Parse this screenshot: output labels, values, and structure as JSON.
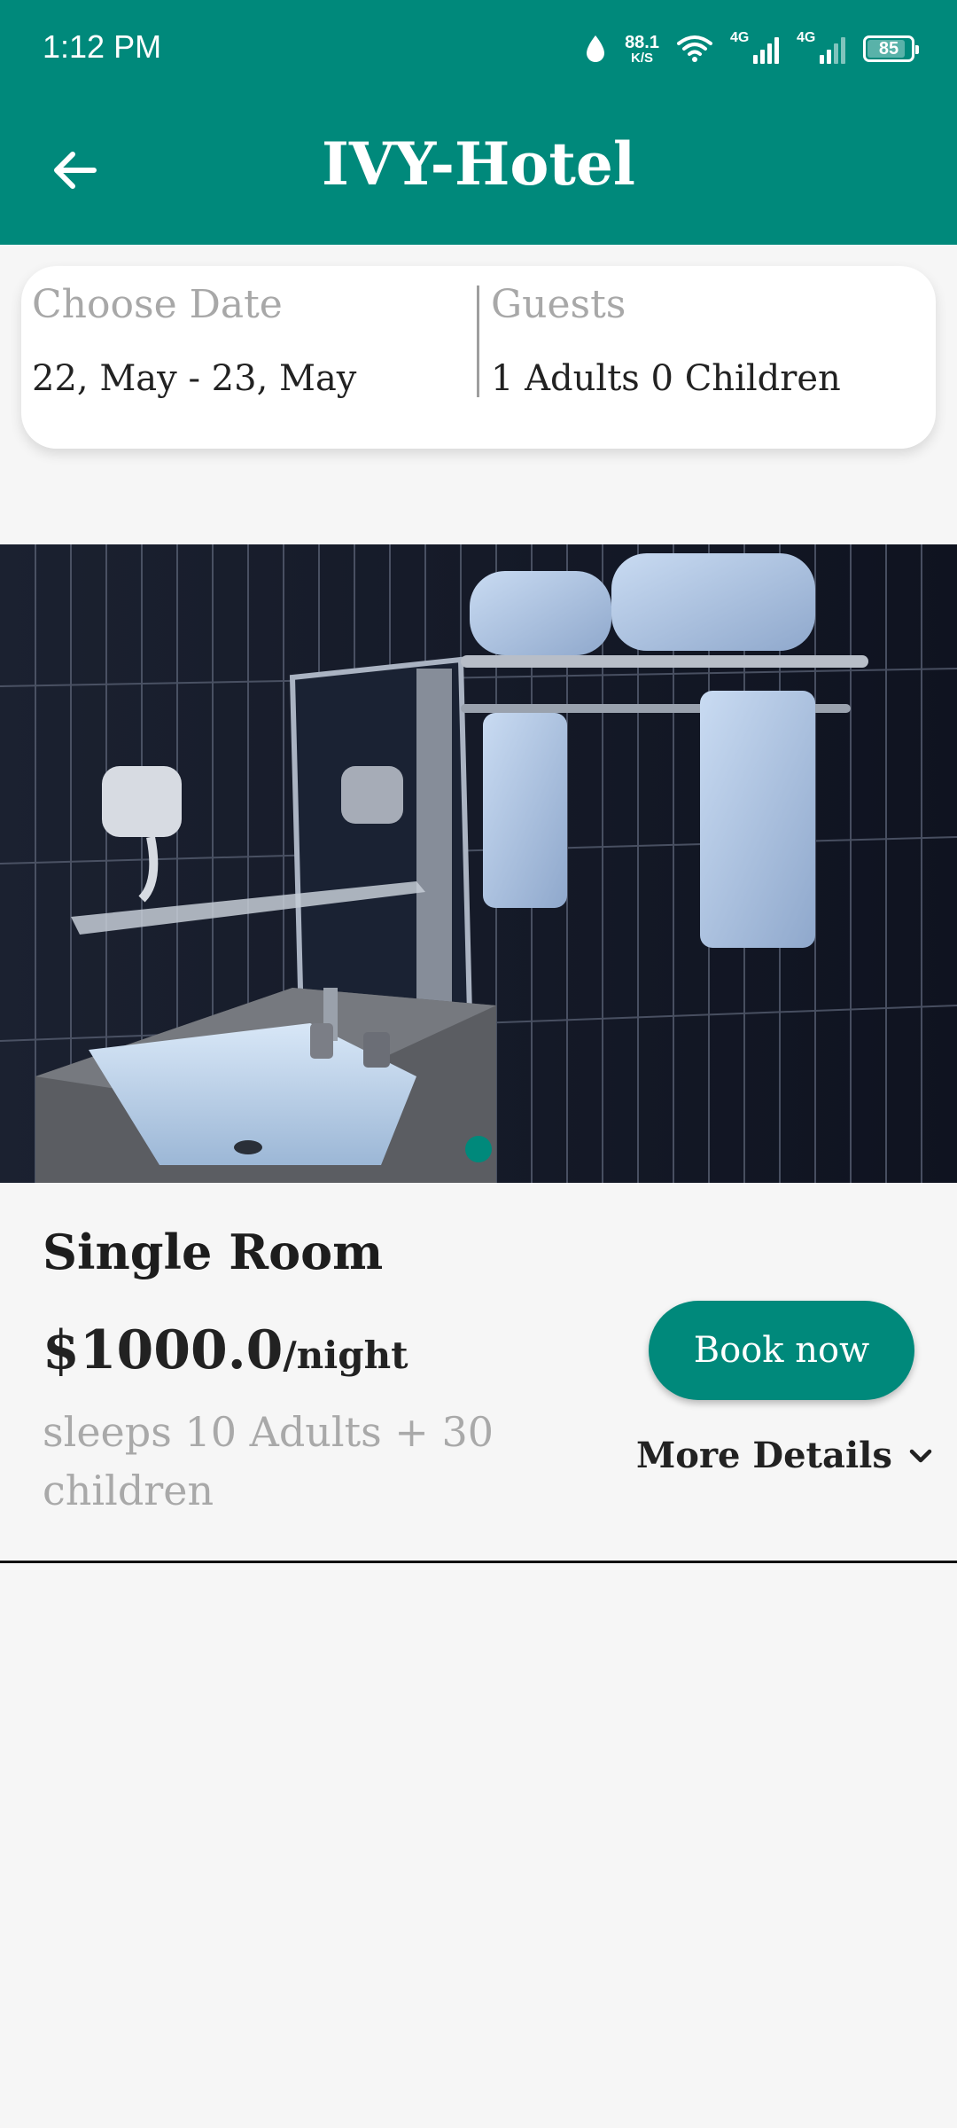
{
  "status_bar": {
    "time": "1:12 PM",
    "net_speed_value": "88.1",
    "net_speed_unit": "K/S",
    "signal1_label": "4G",
    "signal2_label": "4G",
    "battery_level": "85"
  },
  "header": {
    "title": "IVY-Hotel",
    "back_icon": "arrow-left-icon"
  },
  "search": {
    "date_label": "Choose Date",
    "date_value": "22, May - 23, May",
    "guests_label": "Guests",
    "guests_value": "1 Adults 0 Children"
  },
  "room": {
    "image_alt": "hotel bathroom",
    "carousel_active_index": 0,
    "name": "Single Room",
    "price": "$1000.0",
    "price_unit": "/night",
    "capacity": "sleeps 10 Adults + 30 children",
    "book_label": "Book now",
    "details_label": "More Details",
    "details_icon": "chevron-down-icon"
  },
  "colors": {
    "primary": "#00897b",
    "background": "#f6f6f6",
    "muted_text": "#a9a9a9"
  }
}
